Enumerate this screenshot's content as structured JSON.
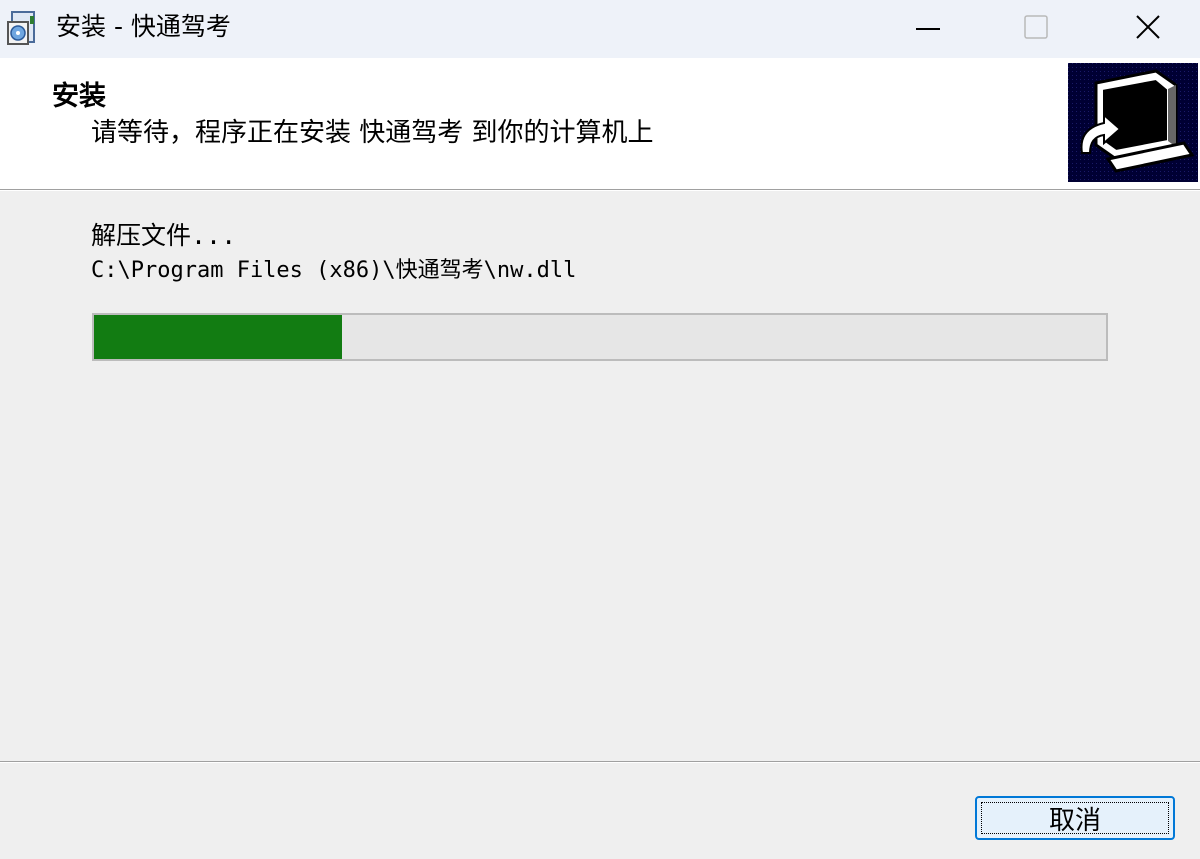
{
  "window": {
    "title": "安装 - 快通驾考",
    "icon": "installer-icon",
    "controls": [
      "minimize-icon",
      "maximize-icon",
      "close-icon"
    ]
  },
  "header": {
    "title": "安装",
    "subtitle": "请等待，程序正在安装 快通驾考 到你的计算机上",
    "image": "computer-install-icon"
  },
  "main": {
    "status": "解压文件...",
    "current_file": "C:\\Program Files (x86)\\快通驾考\\nw.dll",
    "progress": 0.245
  },
  "footer": {
    "cancel_label": "取消"
  },
  "colors": {
    "progress_fill": "#127c12",
    "progress_track": "#e6e6e6",
    "titlebar_bg": "#eef2f9",
    "button_border": "#0078d7"
  }
}
